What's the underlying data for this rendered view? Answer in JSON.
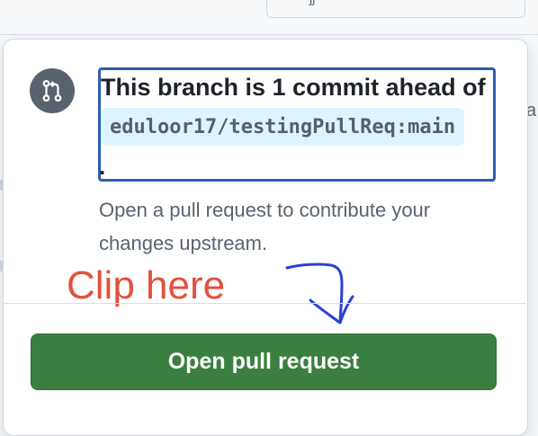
{
  "background": {
    "top_input_glyph": "ʃʃ",
    "right_edge_text": "a"
  },
  "popover": {
    "icon": "git-pull-request-icon",
    "heading": "This branch is 1 commit ahead of",
    "branch_ref": "eduloor17/testingPullReq:main",
    "period": ".",
    "description": "Open a pull request to contribute your changes upstream.",
    "button_label": "Open pull request"
  },
  "annotation": {
    "text": "Clip here",
    "arrow_icon": "hand-drawn-arrow-icon"
  },
  "colors": {
    "button": "#3a7f3f",
    "annotation": "#e4513c",
    "highlight_border": "#2d5cb0",
    "branch_ref_bg": "#ddf4ff"
  }
}
